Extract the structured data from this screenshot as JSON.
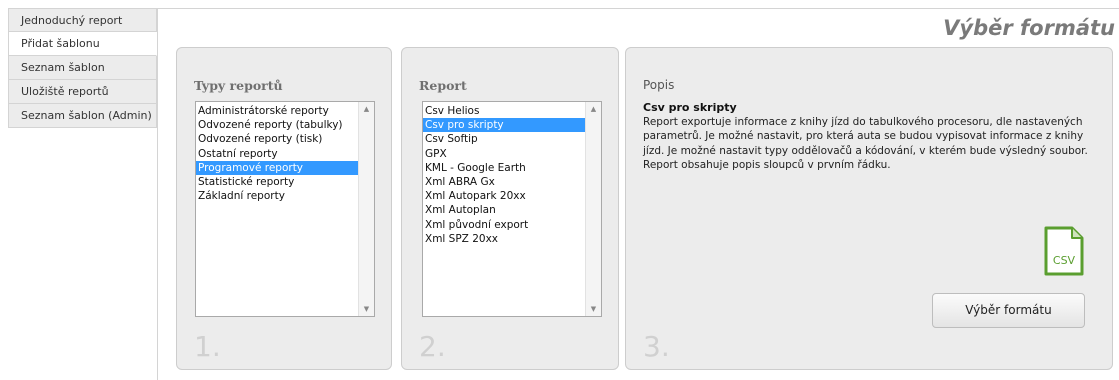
{
  "sidebar": {
    "items": [
      {
        "label": "Jednoduchý report",
        "active": false
      },
      {
        "label": "Přidat šablonu",
        "active": true
      },
      {
        "label": "Seznam šablon",
        "active": false
      },
      {
        "label": "Uložiště reportů",
        "active": false
      },
      {
        "label": "Seznam šablon (Admin)",
        "active": false
      }
    ]
  },
  "header": {
    "title": "Výběr formátu"
  },
  "panel_types": {
    "title": "Typy reportů",
    "step": "1.",
    "items": [
      "Administrátorské reporty",
      "Odvozené reporty (tabulky)",
      "Odvozené reporty (tisk)",
      "Ostatní reporty",
      "Programové reporty",
      "Statistické reporty",
      "Základní reporty"
    ],
    "selected": "Programové reporty"
  },
  "panel_report": {
    "title": "Report",
    "step": "2.",
    "items": [
      "Csv Helios",
      "Csv pro skripty",
      "Csv Softip",
      "GPX",
      "KML - Google Earth",
      "Xml ABRA Gx",
      "Xml Autopark 20xx",
      "Xml Autoplan",
      "Xml původní export",
      "Xml SPZ 20xx"
    ],
    "selected": "Csv pro skripty"
  },
  "panel_desc": {
    "title": "Popis",
    "step": "3.",
    "heading": "Csv pro skripty",
    "text": "Report exportuje informace z knihy jízd do tabulkového procesoru, dle nastavených parametrů. Je možné nastavit, pro která auta se budou vypisovat informace z knihy jízd. Je možné nastavit typy oddělovačů a kódování, v kterém bude výsledný soubor. Report obsahuje popis sloupců v prvním řádku.",
    "icon_label": "CSV",
    "icon": "csv-file-icon",
    "button_label": "Výběr formátu"
  },
  "colors": {
    "selection": "#3399ff",
    "icon_green": "#5a9e2f",
    "panel_bg": "#ececec"
  }
}
